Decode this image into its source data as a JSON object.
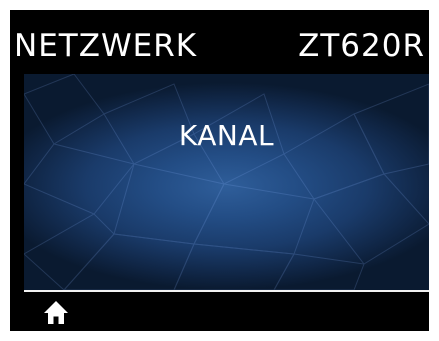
{
  "header": {
    "title": "NETZWERK",
    "model": "ZT620R"
  },
  "main": {
    "label": "KANAL"
  },
  "footer": {
    "home_icon": "home-icon"
  },
  "colors": {
    "screen_background": "#000000",
    "content_center": "#2f5e9a",
    "content_edge": "#0a1a30",
    "text": "#ffffff"
  }
}
